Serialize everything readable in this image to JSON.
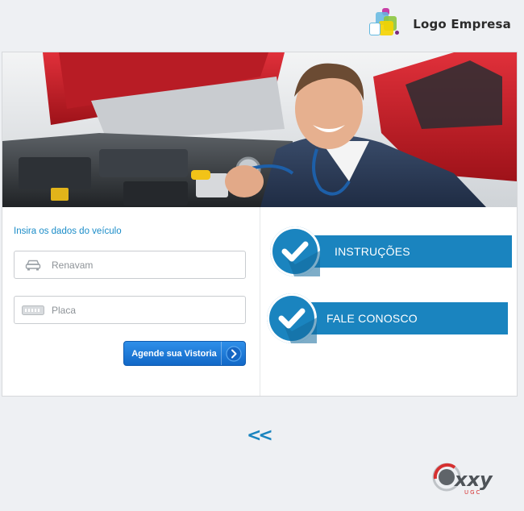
{
  "header": {
    "logo_text": "Logo Empresa",
    "logo_icon": "colored-squares-icon"
  },
  "hero": {
    "image": "mechanic-with-stethoscope-at-car-engine"
  },
  "form": {
    "title": "Insira os dados do veículo",
    "renavam": {
      "placeholder": "Renavam",
      "value": "",
      "icon": "car-icon"
    },
    "placa": {
      "placeholder": "Placa",
      "value": "",
      "icon": "license-plate-icon"
    },
    "submit_label": "Agende sua Vistoria",
    "submit_icon": "arrow-right-icon"
  },
  "menu": {
    "items": [
      {
        "label": "INSTRUÇÕES",
        "icon": "check-icon"
      },
      {
        "label": "FALE CONOSCO",
        "icon": "check-icon"
      }
    ]
  },
  "nav": {
    "back_label": "<<"
  },
  "footer": {
    "brand": "Oxxy",
    "brand_sub": "UGC"
  },
  "colors": {
    "accent": "#1a84bf",
    "button": "#1f7bd8",
    "link": "#1a8cc8",
    "background": "#eef0f3"
  }
}
